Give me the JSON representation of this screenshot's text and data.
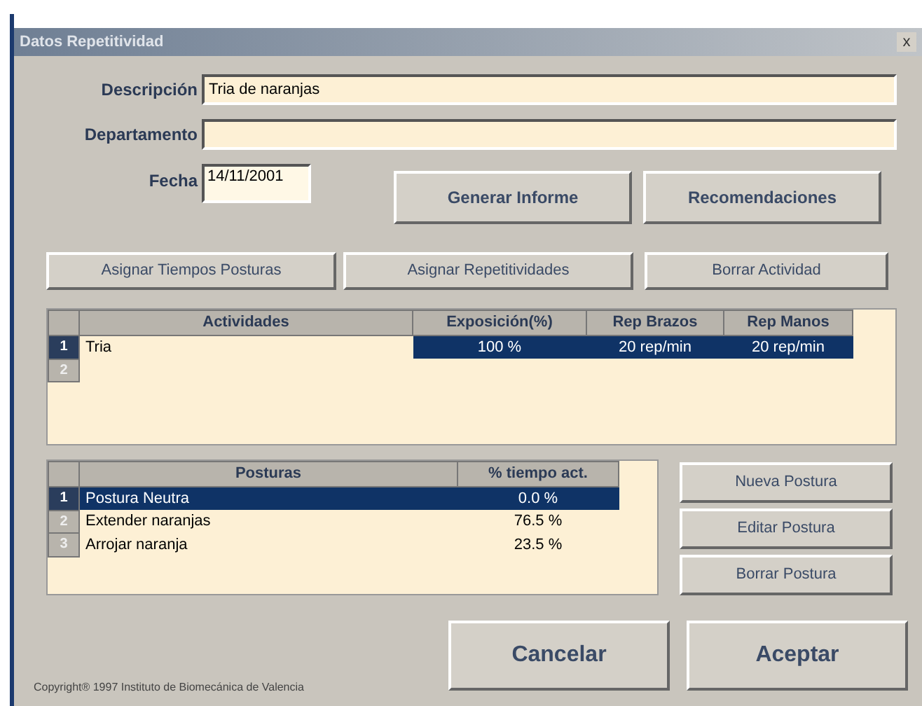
{
  "window": {
    "title": "Datos Repetitividad",
    "close": "x"
  },
  "form": {
    "fields": [
      {
        "label": "Descripción",
        "value": "Tria de naranjas"
      },
      {
        "label": "Departamento"
      }
    ],
    "date": {
      "label": "Fecha",
      "value": "14/11/2001"
    }
  },
  "top_buttons": [
    "Generar Informe",
    "Recomendaciones"
  ],
  "action_buttons": [
    "Asignar Tiempos Posturas",
    "Asignar Repetitividades",
    "Borrar Actividad"
  ],
  "activities": {
    "columns": [
      "Actividades",
      "Exposición(%)",
      "Rep Brazos",
      "Rep Manos"
    ],
    "rows": [
      {
        "index": "1",
        "cells": [
          "Tria",
          "100 %",
          "20 rep/min",
          "20 rep/min"
        ],
        "selected": true
      },
      {
        "index": "2",
        "cells": [],
        "selected": false
      }
    ]
  },
  "postures": {
    "columns": [
      "Posturas",
      "% tiempo act."
    ],
    "rows": [
      {
        "index": "1",
        "cells": [
          "Postura Neutra",
          "0.0 %"
        ],
        "selected": true
      },
      {
        "index": "2",
        "cells": [
          "Extender naranjas",
          "76.5 %"
        ],
        "selected": false
      },
      {
        "index": "3",
        "cells": [
          "Arrojar naranja",
          "23.5 %"
        ],
        "selected": false
      }
    ]
  },
  "posture_buttons": [
    "Nueva Postura",
    "Editar Postura",
    "Borrar Postura"
  ],
  "dialog_buttons": [
    "Cancelar",
    "Aceptar"
  ],
  "copyright": "Copyright® 1997 Instituto de Biomecánica de Valencia"
}
